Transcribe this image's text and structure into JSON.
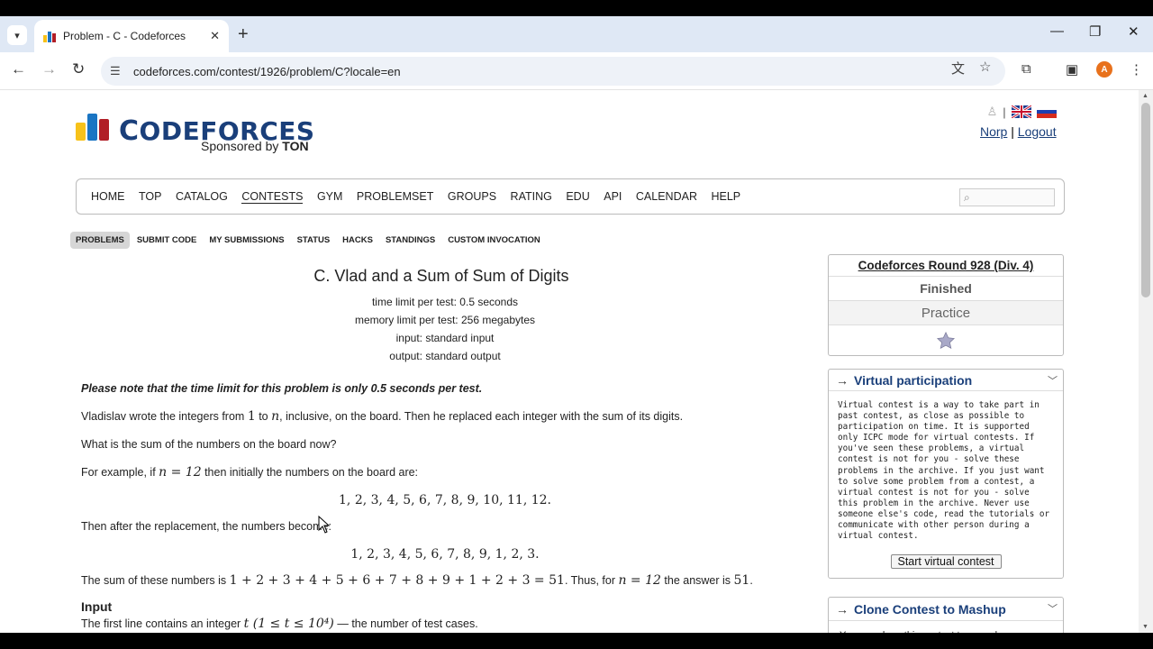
{
  "browser": {
    "tab_title": "Problem - C - Codeforces",
    "url": "codeforces.com/contest/1926/problem/C?locale=en",
    "avatar_letter": "A"
  },
  "header": {
    "logo_text_big": "C",
    "logo_text_rest": "ODEFORCES",
    "sponsored_prefix": "Sponsored by ",
    "sponsor": "TON",
    "user": "Norp",
    "separator": "|",
    "logout": "Logout"
  },
  "menu": [
    "HOME",
    "TOP",
    "CATALOG",
    "CONTESTS",
    "GYM",
    "PROBLEMSET",
    "GROUPS",
    "RATING",
    "EDU",
    "API",
    "CALENDAR",
    "HELP"
  ],
  "submenu": [
    "PROBLEMS",
    "SUBMIT CODE",
    "MY SUBMISSIONS",
    "STATUS",
    "HACKS",
    "STANDINGS",
    "CUSTOM INVOCATION"
  ],
  "problem": {
    "title": "C. Vlad and a Sum of Sum of Digits",
    "time_limit": "time limit per test: 0.5 seconds",
    "memory_limit": "memory limit per test: 256 megabytes",
    "input": "input: standard input",
    "output": "output: standard output",
    "note": "Please note that the time limit for this problem is only 0.5 seconds per test.",
    "p1_a": "Vladislav wrote the integers from ",
    "p1_m1": "1",
    "p1_b": " to ",
    "p1_m2": "n",
    "p1_c": ", inclusive, on the board. Then he replaced each integer with the sum of its digits.",
    "p2": "What is the sum of the numbers on the board now?",
    "p3_a": "For example, if ",
    "p3_m": "n = 12",
    "p3_b": " then initially the numbers on the board are:",
    "display1": "1, 2, 3, 4, 5, 6, 7, 8, 9, 10, 11, 12.",
    "p4": "Then after the replacement, the numbers become:",
    "display2": "1, 2, 3, 4, 5, 6, 7, 8, 9, 1, 2, 3.",
    "p5_a": "The sum of these numbers is ",
    "p5_m": "1 + 2 + 3 + 4 + 5 + 6 + 7 + 8 + 9 + 1 + 2 + 3 = 51",
    "p5_b": ". Thus, for ",
    "p5_m2": "n = 12",
    "p5_c": " the answer is ",
    "p5_m3": "51",
    "p5_d": ".",
    "input_heading": "Input",
    "input_a": "The first line contains an integer ",
    "input_m": "t (1 ≤ t ≤ 10⁴)",
    "input_b": " — the number of test cases."
  },
  "sidebar": {
    "contest_name": "Codeforces Round 928 (Div. 4)",
    "status": "Finished",
    "mode": "Practice",
    "virtual_title": "Virtual participation",
    "virtual_text": "Virtual contest is a way to take part in past contest, as close as possible to participation on time. It is supported only ICPC mode for virtual contests. If you've seen these problems, a virtual contest is not for you - solve these problems in the archive. If you just want to solve some problem from a contest, a virtual contest is not for you - solve this problem in the archive. Never use someone else's code, read the tutorials or communicate with other person during a virtual contest.",
    "virtual_button": "Start virtual contest",
    "clone_title": "Clone Contest to Mashup",
    "clone_text": "You can clone this contest to a mashup."
  },
  "colors": {
    "link": "#1a3f7a",
    "bar_yellow": "#f7c21a",
    "bar_blue": "#1a75c3",
    "bar_red": "#b11e26"
  }
}
